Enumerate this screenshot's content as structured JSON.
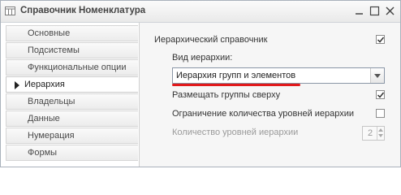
{
  "window": {
    "title": "Справочник Номенклатура"
  },
  "nav": [
    {
      "label": "Основные"
    },
    {
      "label": "Подсистемы"
    },
    {
      "label": "Функциональные опции"
    },
    {
      "label": "Иерархия",
      "active": true
    },
    {
      "label": "Владельцы"
    },
    {
      "label": "Данные"
    },
    {
      "label": "Нумерация"
    },
    {
      "label": "Формы"
    }
  ],
  "form": {
    "hierarchical_label": "Иерархический справочник",
    "hierarchical_checked": true,
    "hierarchy_type_label": "Вид иерархии:",
    "hierarchy_type_value": "Иерархия групп и элементов",
    "groups_on_top_label": "Размещать группы сверху",
    "groups_on_top_checked": true,
    "limit_levels_label": "Ограничение количества уровней иерархии",
    "limit_levels_checked": false,
    "levels_count_label": "Количество уровней иерархии",
    "levels_count_value": "2"
  },
  "colors": {
    "underline": "#e2191b",
    "window_border": "#a9b1bb"
  }
}
